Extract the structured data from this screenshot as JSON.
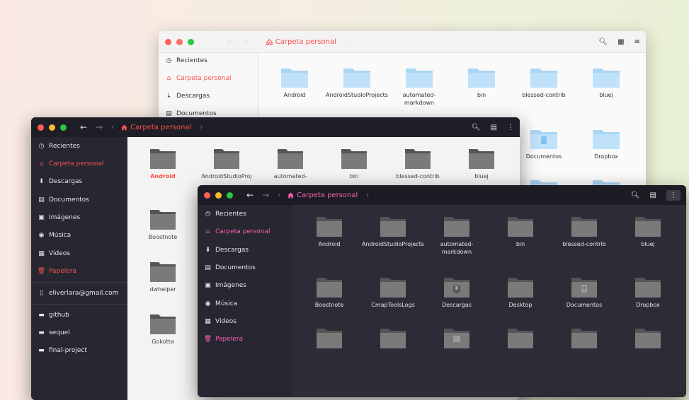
{
  "window_light": {
    "path": "Carpeta personal",
    "sidebar": [
      {
        "label": "Recientes",
        "icon": "clock-icon"
      },
      {
        "label": "Carpeta personal",
        "icon": "home-icon",
        "active": true
      },
      {
        "label": "Descargas",
        "icon": "download-icon"
      },
      {
        "label": "Documentos",
        "icon": "document-icon"
      }
    ],
    "files": [
      "Android",
      "AndroidStudioProjects",
      "automated-markdown",
      "bin",
      "blessed-contrib",
      "bluej",
      "Documentos",
      "Dropbox"
    ]
  },
  "window_mid": {
    "path": "Carpeta personal",
    "sidebar": [
      {
        "label": "Recientes",
        "icon": "clock-icon"
      },
      {
        "label": "Carpeta personal",
        "icon": "home-icon",
        "active": true
      },
      {
        "label": "Descargas",
        "icon": "download-icon"
      },
      {
        "label": "Documentos",
        "icon": "document-icon"
      },
      {
        "label": "Imágenes",
        "icon": "image-icon"
      },
      {
        "label": "Música",
        "icon": "music-icon"
      },
      {
        "label": "Videos",
        "icon": "video-icon"
      },
      {
        "label": "Papelera",
        "icon": "trash-icon"
      },
      {
        "label": "eliverlara@gmail.com",
        "icon": "account-icon"
      },
      {
        "label": "github",
        "icon": "folder-icon"
      },
      {
        "label": "sequel",
        "icon": "folder-icon"
      },
      {
        "label": "final-project",
        "icon": "folder-icon"
      }
    ],
    "files": [
      "Android",
      "AndroidStudioProj",
      "automated-",
      "bin",
      "blessed-contrib",
      "bluej",
      "Boostnote",
      "dwhelper",
      "Gokotta"
    ]
  },
  "window_dark": {
    "path": "Carpeta personal",
    "sidebar": [
      {
        "label": "Recientes",
        "icon": "clock-icon"
      },
      {
        "label": "Carpeta personal",
        "icon": "home-icon",
        "active": true
      },
      {
        "label": "Descargas",
        "icon": "download-icon"
      },
      {
        "label": "Documentos",
        "icon": "document-icon"
      },
      {
        "label": "Imágenes",
        "icon": "image-icon"
      },
      {
        "label": "Música",
        "icon": "music-icon"
      },
      {
        "label": "Videos",
        "icon": "video-icon"
      },
      {
        "label": "Papelera",
        "icon": "trash-icon"
      }
    ],
    "files": [
      "Android",
      "AndroidStudioProjects",
      "automated-markdown",
      "bin",
      "blessed-contrib",
      "bluej",
      "Boostnote",
      "CmapToolsLogs",
      "Descargas",
      "Desktop",
      "Documentos",
      "Dropbox"
    ]
  },
  "colors": {
    "close": "#ff5f57",
    "minimize": "#ffbd2e",
    "maximize": "#28c940",
    "accent_red": "#ff4f4f",
    "accent_pink": "#ff5fb4"
  }
}
